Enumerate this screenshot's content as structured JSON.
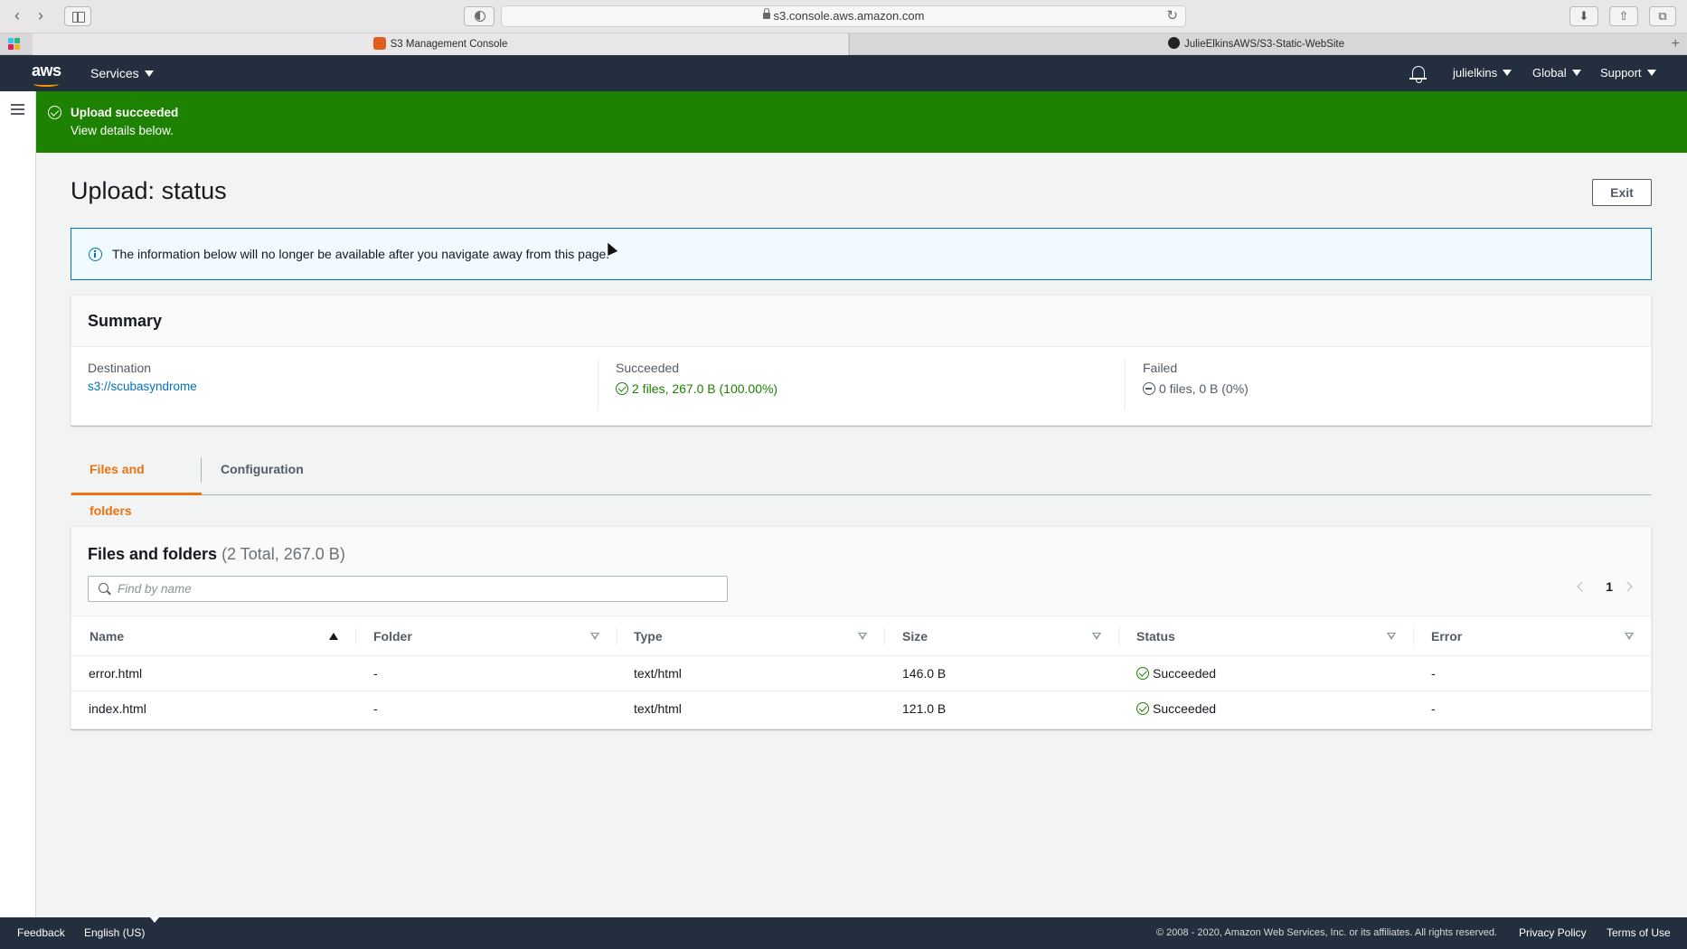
{
  "browser": {
    "url": "s3.console.aws.amazon.com",
    "tabs": [
      {
        "label": "S3 Management Console"
      },
      {
        "label": "JulieElkinsAWS/S3-Static-WebSite"
      }
    ]
  },
  "header": {
    "services_label": "Services",
    "user_label": "julielkins",
    "region_label": "Global",
    "support_label": "Support"
  },
  "flash": {
    "title": "Upload succeeded",
    "subtitle": "View details below."
  },
  "page": {
    "title": "Upload: status",
    "exit_label": "Exit"
  },
  "info": {
    "text": "The information below will no longer be available after you navigate away from this page."
  },
  "summary": {
    "title": "Summary",
    "destination_label": "Destination",
    "destination_value": "s3://scubasyndrome",
    "succeeded_label": "Succeeded",
    "succeeded_value": "2 files, 267.0 B (100.00%)",
    "failed_label": "Failed",
    "failed_value": "0 files, 0 B (0%)"
  },
  "tabs": [
    {
      "label": "Files and folders",
      "active": true
    },
    {
      "label": "Configuration",
      "active": false
    }
  ],
  "files": {
    "title": "Files and folders",
    "count": "(2 Total, 267.0 B)",
    "search_placeholder": "Find by name",
    "page": "1",
    "columns": [
      "Name",
      "Folder",
      "Type",
      "Size",
      "Status",
      "Error"
    ],
    "rows": [
      {
        "name": "error.html",
        "folder": "-",
        "type": "text/html",
        "size": "146.0 B",
        "status": "Succeeded",
        "error": "-"
      },
      {
        "name": "index.html",
        "folder": "-",
        "type": "text/html",
        "size": "121.0 B",
        "status": "Succeeded",
        "error": "-"
      }
    ]
  },
  "footer": {
    "feedback": "Feedback",
    "language": "English (US)",
    "copyright": "© 2008 - 2020, Amazon Web Services, Inc. or its affiliates. All rights reserved.",
    "privacy": "Privacy Policy",
    "terms": "Terms of Use"
  },
  "colors": {
    "success": "#1d8102",
    "link": "#0073bb",
    "accent": "#ec7211",
    "header_bg": "#232f3e"
  }
}
